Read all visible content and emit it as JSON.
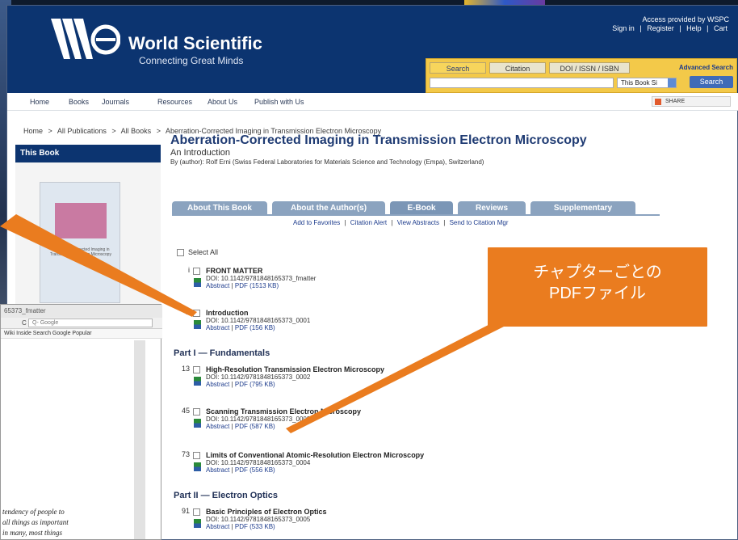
{
  "header": {
    "logo_name": "World Scientific",
    "logo_tagline": "Connecting Great Minds",
    "access_line": "Access provided by WSPC",
    "account_links": [
      "Sign in",
      "Register",
      "Help",
      "Cart"
    ],
    "link_separator": "|"
  },
  "search": {
    "tabs": [
      "Search",
      "Citation",
      "DOI / ISSN / ISBN"
    ],
    "advanced_label": "Advanced Search",
    "scope_value": "This Book Si",
    "button_label": "Search"
  },
  "nav": {
    "items": [
      "Home",
      "Books",
      "Journals",
      "Resources",
      "About Us",
      "Publish with Us"
    ],
    "share_label": "SHARE"
  },
  "breadcrumb": {
    "items": [
      "Home",
      "All Publications",
      "All Books",
      "Aberration-Corrected Imaging in Transmission Electron Microscopy"
    ],
    "separator": ">"
  },
  "sidebar": {
    "title": "This Book"
  },
  "book": {
    "title": "Aberration-Corrected Imaging in Transmission Electron Microscopy",
    "subtitle": "An Introduction",
    "byline": "By (author): Rolf Erni (Swiss Federal Laboratories for Materials Science and Technology (Empa), Switzerland)"
  },
  "tabs": [
    "About This Book",
    "About the Author(s)",
    "E-Book",
    "Reviews",
    "Supplementary"
  ],
  "actions": {
    "items": [
      "Add to Favorites",
      "Citation Alert",
      "View Abstracts",
      "Send to Citation Mgr"
    ],
    "separator": "|"
  },
  "toc": {
    "select_all": "Select All",
    "abstract_label": "Abstract",
    "pdf_label": "PDF",
    "link_separator": "|",
    "part1": "Part I — Fundamentals",
    "part2": "Part II — Electron Optics",
    "entries": [
      {
        "page": "i",
        "title": "FRONT MATTER",
        "doi": "DOI: 10.1142/9781848165373_fmatter",
        "size": "(1513 KB)"
      },
      {
        "page": "1",
        "title": "Introduction",
        "doi": "DOI: 10.1142/9781848165373_0001",
        "size": "(156 KB)"
      },
      {
        "page": "13",
        "title": "High-Resolution Transmission Electron Microscopy",
        "doi": "DOI: 10.1142/9781848165373_0002",
        "size": "(795 KB)"
      },
      {
        "page": "45",
        "title": "Scanning Transmission Electron Microscopy",
        "doi": "DOI: 10.1142/9781848165373_0003",
        "size": "(587 KB)"
      },
      {
        "page": "73",
        "title": "Limits of Conventional Atomic-Resolution Electron Microscopy",
        "doi": "DOI: 10.1142/9781848165373_0004",
        "size": "(556 KB)"
      },
      {
        "page": "91",
        "title": "Basic Principles of Electron Optics",
        "doi": "DOI: 10.1142/9781848165373_0005",
        "size": "(533 KB)"
      }
    ]
  },
  "callout": {
    "line1": "チャプターごとの",
    "line2": "PDFファイル",
    "color": "#ea7c1f"
  },
  "snippet": {
    "title": "65373_fmatter",
    "go": "C",
    "search_placeholder": "Q- Google",
    "bookmarks": "Wiki  Inside Search  Google  Popular",
    "text": [
      "tendency of people to",
      "all things as important",
      "in many, most things"
    ]
  },
  "colors": {
    "brand_navy": "#0c3470",
    "search_gold": "#f3c949",
    "tab_blue": "#8ba3bf"
  }
}
